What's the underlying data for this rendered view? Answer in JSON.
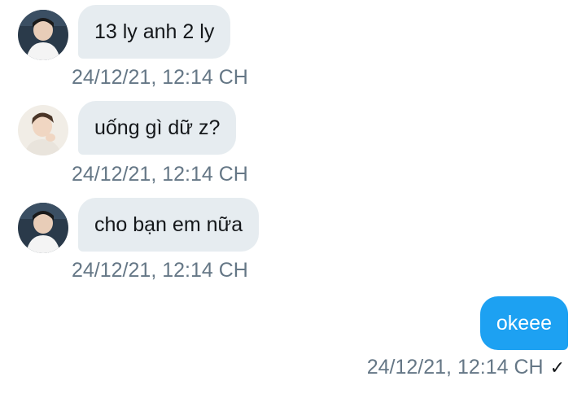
{
  "messages": [
    {
      "direction": "incoming",
      "text": "13 ly anh 2 ly",
      "time": "24/12/21, 12:14 CH",
      "avatar": "avatar-white-shirt"
    },
    {
      "direction": "incoming",
      "text": "uống gì dữ z?",
      "time": "24/12/21, 12:14 CH",
      "avatar": "avatar-hand-on-chin"
    },
    {
      "direction": "incoming",
      "text": "cho bạn em nữa",
      "time": "24/12/21, 12:14 CH",
      "avatar": "avatar-white-shirt"
    },
    {
      "direction": "outgoing",
      "text": "okeee",
      "time": "24/12/21, 12:14 CH",
      "status_icon": "checkmark-icon",
      "status_glyph": "✓"
    }
  ],
  "colors": {
    "incoming_bubble": "#e6ecf0",
    "outgoing_bubble": "#1da1f2",
    "timestamp": "#657786",
    "text": "#14171a"
  }
}
